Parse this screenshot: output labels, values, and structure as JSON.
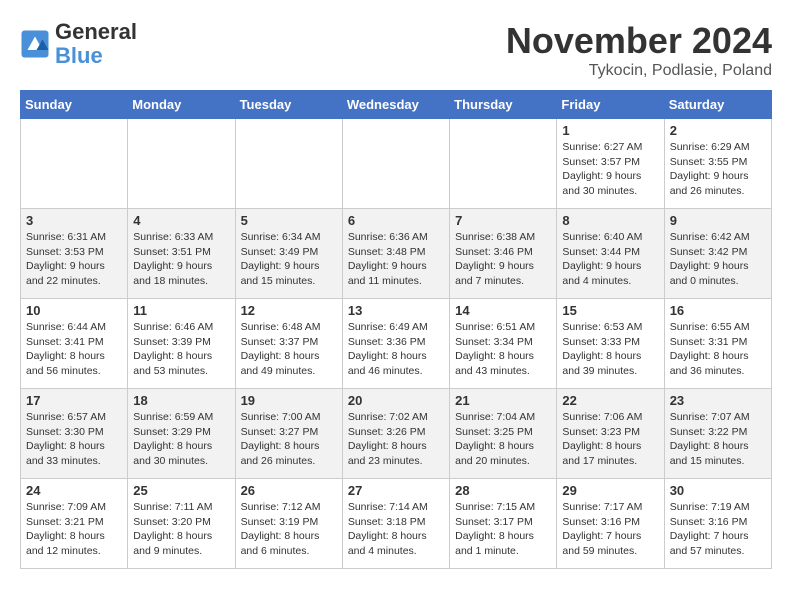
{
  "header": {
    "logo": {
      "general": "General",
      "blue": "Blue"
    },
    "title": "November 2024",
    "location": "Tykocin, Podlasie, Poland"
  },
  "days_of_week": [
    "Sunday",
    "Monday",
    "Tuesday",
    "Wednesday",
    "Thursday",
    "Friday",
    "Saturday"
  ],
  "weeks": [
    [
      {
        "day": "",
        "info": ""
      },
      {
        "day": "",
        "info": ""
      },
      {
        "day": "",
        "info": ""
      },
      {
        "day": "",
        "info": ""
      },
      {
        "day": "",
        "info": ""
      },
      {
        "day": "1",
        "info": "Sunrise: 6:27 AM\nSunset: 3:57 PM\nDaylight: 9 hours and 30 minutes."
      },
      {
        "day": "2",
        "info": "Sunrise: 6:29 AM\nSunset: 3:55 PM\nDaylight: 9 hours and 26 minutes."
      }
    ],
    [
      {
        "day": "3",
        "info": "Sunrise: 6:31 AM\nSunset: 3:53 PM\nDaylight: 9 hours and 22 minutes."
      },
      {
        "day": "4",
        "info": "Sunrise: 6:33 AM\nSunset: 3:51 PM\nDaylight: 9 hours and 18 minutes."
      },
      {
        "day": "5",
        "info": "Sunrise: 6:34 AM\nSunset: 3:49 PM\nDaylight: 9 hours and 15 minutes."
      },
      {
        "day": "6",
        "info": "Sunrise: 6:36 AM\nSunset: 3:48 PM\nDaylight: 9 hours and 11 minutes."
      },
      {
        "day": "7",
        "info": "Sunrise: 6:38 AM\nSunset: 3:46 PM\nDaylight: 9 hours and 7 minutes."
      },
      {
        "day": "8",
        "info": "Sunrise: 6:40 AM\nSunset: 3:44 PM\nDaylight: 9 hours and 4 minutes."
      },
      {
        "day": "9",
        "info": "Sunrise: 6:42 AM\nSunset: 3:42 PM\nDaylight: 9 hours and 0 minutes."
      }
    ],
    [
      {
        "day": "10",
        "info": "Sunrise: 6:44 AM\nSunset: 3:41 PM\nDaylight: 8 hours and 56 minutes."
      },
      {
        "day": "11",
        "info": "Sunrise: 6:46 AM\nSunset: 3:39 PM\nDaylight: 8 hours and 53 minutes."
      },
      {
        "day": "12",
        "info": "Sunrise: 6:48 AM\nSunset: 3:37 PM\nDaylight: 8 hours and 49 minutes."
      },
      {
        "day": "13",
        "info": "Sunrise: 6:49 AM\nSunset: 3:36 PM\nDaylight: 8 hours and 46 minutes."
      },
      {
        "day": "14",
        "info": "Sunrise: 6:51 AM\nSunset: 3:34 PM\nDaylight: 8 hours and 43 minutes."
      },
      {
        "day": "15",
        "info": "Sunrise: 6:53 AM\nSunset: 3:33 PM\nDaylight: 8 hours and 39 minutes."
      },
      {
        "day": "16",
        "info": "Sunrise: 6:55 AM\nSunset: 3:31 PM\nDaylight: 8 hours and 36 minutes."
      }
    ],
    [
      {
        "day": "17",
        "info": "Sunrise: 6:57 AM\nSunset: 3:30 PM\nDaylight: 8 hours and 33 minutes."
      },
      {
        "day": "18",
        "info": "Sunrise: 6:59 AM\nSunset: 3:29 PM\nDaylight: 8 hours and 30 minutes."
      },
      {
        "day": "19",
        "info": "Sunrise: 7:00 AM\nSunset: 3:27 PM\nDaylight: 8 hours and 26 minutes."
      },
      {
        "day": "20",
        "info": "Sunrise: 7:02 AM\nSunset: 3:26 PM\nDaylight: 8 hours and 23 minutes."
      },
      {
        "day": "21",
        "info": "Sunrise: 7:04 AM\nSunset: 3:25 PM\nDaylight: 8 hours and 20 minutes."
      },
      {
        "day": "22",
        "info": "Sunrise: 7:06 AM\nSunset: 3:23 PM\nDaylight: 8 hours and 17 minutes."
      },
      {
        "day": "23",
        "info": "Sunrise: 7:07 AM\nSunset: 3:22 PM\nDaylight: 8 hours and 15 minutes."
      }
    ],
    [
      {
        "day": "24",
        "info": "Sunrise: 7:09 AM\nSunset: 3:21 PM\nDaylight: 8 hours and 12 minutes."
      },
      {
        "day": "25",
        "info": "Sunrise: 7:11 AM\nSunset: 3:20 PM\nDaylight: 8 hours and 9 minutes."
      },
      {
        "day": "26",
        "info": "Sunrise: 7:12 AM\nSunset: 3:19 PM\nDaylight: 8 hours and 6 minutes."
      },
      {
        "day": "27",
        "info": "Sunrise: 7:14 AM\nSunset: 3:18 PM\nDaylight: 8 hours and 4 minutes."
      },
      {
        "day": "28",
        "info": "Sunrise: 7:15 AM\nSunset: 3:17 PM\nDaylight: 8 hours and 1 minute."
      },
      {
        "day": "29",
        "info": "Sunrise: 7:17 AM\nSunset: 3:16 PM\nDaylight: 7 hours and 59 minutes."
      },
      {
        "day": "30",
        "info": "Sunrise: 7:19 AM\nSunset: 3:16 PM\nDaylight: 7 hours and 57 minutes."
      }
    ]
  ]
}
